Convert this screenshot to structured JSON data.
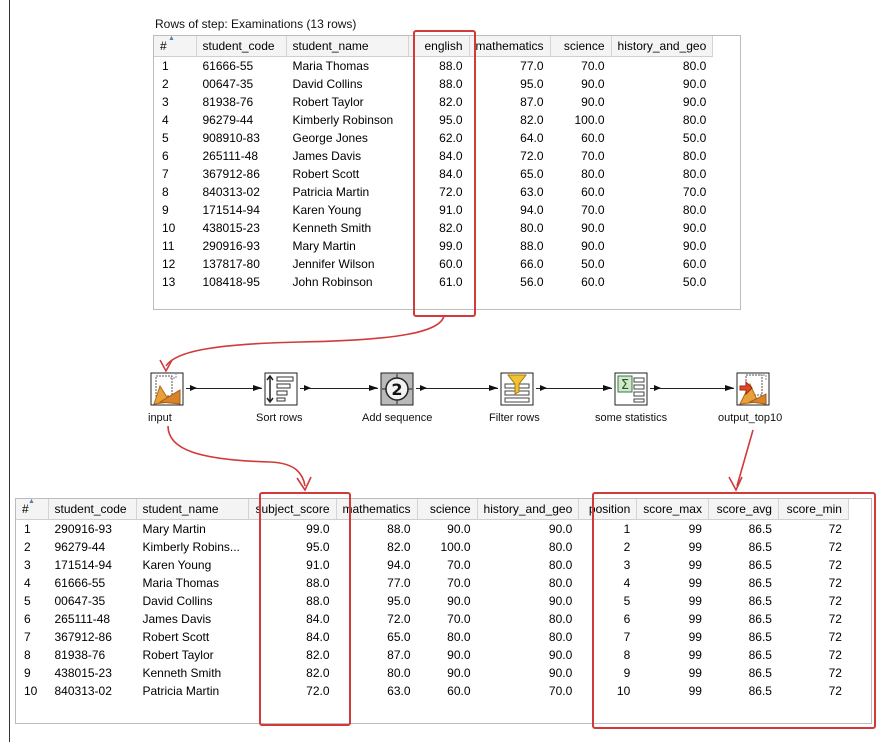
{
  "top_table": {
    "caption": "Rows of step: Examinations (13 rows)",
    "columns": [
      "#",
      "student_code",
      "student_name",
      "english",
      "mathematics",
      "science",
      "history_and_geo"
    ],
    "rows": [
      [
        "1",
        "61666-55",
        "Maria Thomas",
        "88.0",
        "77.0",
        "70.0",
        "80.0"
      ],
      [
        "2",
        "00647-35",
        "David Collins",
        "88.0",
        "95.0",
        "90.0",
        "90.0"
      ],
      [
        "3",
        "81938-76",
        "Robert Taylor",
        "82.0",
        "87.0",
        "90.0",
        "90.0"
      ],
      [
        "4",
        "96279-44",
        "Kimberly Robinson",
        "95.0",
        "82.0",
        "100.0",
        "80.0"
      ],
      [
        "5",
        "908910-83",
        "George Jones",
        "62.0",
        "64.0",
        "60.0",
        "50.0"
      ],
      [
        "6",
        "265111-48",
        "James Davis",
        "84.0",
        "72.0",
        "70.0",
        "80.0"
      ],
      [
        "7",
        "367912-86",
        "Robert Scott",
        "84.0",
        "65.0",
        "80.0",
        "80.0"
      ],
      [
        "8",
        "840313-02",
        "Patricia Martin",
        "72.0",
        "63.0",
        "60.0",
        "70.0"
      ],
      [
        "9",
        "171514-94",
        "Karen Young",
        "91.0",
        "94.0",
        "70.0",
        "80.0"
      ],
      [
        "10",
        "438015-23",
        "Kenneth Smith",
        "82.0",
        "80.0",
        "90.0",
        "90.0"
      ],
      [
        "11",
        "290916-93",
        "Mary Martin",
        "99.0",
        "88.0",
        "90.0",
        "90.0"
      ],
      [
        "12",
        "137817-80",
        "Jennifer Wilson",
        "60.0",
        "66.0",
        "50.0",
        "60.0"
      ],
      [
        "13",
        "108418-95",
        "John Robinson",
        "61.0",
        "56.0",
        "60.0",
        "50.0"
      ]
    ]
  },
  "flow": {
    "steps": [
      {
        "id": "input",
        "label": "input",
        "icon": "input-file-icon"
      },
      {
        "id": "sort",
        "label": "Sort rows",
        "icon": "sort-rows-icon"
      },
      {
        "id": "seq",
        "label": "Add sequence",
        "icon": "add-sequence-icon",
        "glyph": "2"
      },
      {
        "id": "filter",
        "label": "Filter rows",
        "icon": "filter-rows-icon"
      },
      {
        "id": "stats",
        "label": "some statistics",
        "icon": "statistics-icon",
        "glyph": "Σ"
      },
      {
        "id": "output",
        "label": "output_top10",
        "icon": "output-file-icon"
      }
    ]
  },
  "bottom_table": {
    "columns": [
      "#",
      "student_code",
      "student_name",
      "subject_score",
      "mathematics",
      "science",
      "history_and_geo",
      "position",
      "score_max",
      "score_avg",
      "score_min"
    ],
    "rows": [
      [
        "1",
        "290916-93",
        "Mary Martin",
        "99.0",
        "88.0",
        "90.0",
        "90.0",
        "1",
        "99",
        "86.5",
        "72"
      ],
      [
        "2",
        "96279-44",
        "Kimberly Robins...",
        "95.0",
        "82.0",
        "100.0",
        "80.0",
        "2",
        "99",
        "86.5",
        "72"
      ],
      [
        "3",
        "171514-94",
        "Karen Young",
        "91.0",
        "94.0",
        "70.0",
        "80.0",
        "3",
        "99",
        "86.5",
        "72"
      ],
      [
        "4",
        "61666-55",
        "Maria Thomas",
        "88.0",
        "77.0",
        "70.0",
        "80.0",
        "4",
        "99",
        "86.5",
        "72"
      ],
      [
        "5",
        "00647-35",
        "David Collins",
        "88.0",
        "95.0",
        "90.0",
        "90.0",
        "5",
        "99",
        "86.5",
        "72"
      ],
      [
        "6",
        "265111-48",
        "James Davis",
        "84.0",
        "72.0",
        "70.0",
        "80.0",
        "6",
        "99",
        "86.5",
        "72"
      ],
      [
        "7",
        "367912-86",
        "Robert Scott",
        "84.0",
        "65.0",
        "80.0",
        "80.0",
        "7",
        "99",
        "86.5",
        "72"
      ],
      [
        "8",
        "81938-76",
        "Robert Taylor",
        "82.0",
        "87.0",
        "90.0",
        "90.0",
        "8",
        "99",
        "86.5",
        "72"
      ],
      [
        "9",
        "438015-23",
        "Kenneth Smith",
        "82.0",
        "80.0",
        "90.0",
        "90.0",
        "9",
        "99",
        "86.5",
        "72"
      ],
      [
        "10",
        "840313-02",
        "Patricia Martin",
        "72.0",
        "63.0",
        "60.0",
        "70.0",
        "10",
        "99",
        "86.5",
        "72"
      ]
    ]
  },
  "colors": {
    "highlight": "#d23a3a",
    "header_bg": "#f4f4f4",
    "grid_border": "#bcbcbc"
  }
}
